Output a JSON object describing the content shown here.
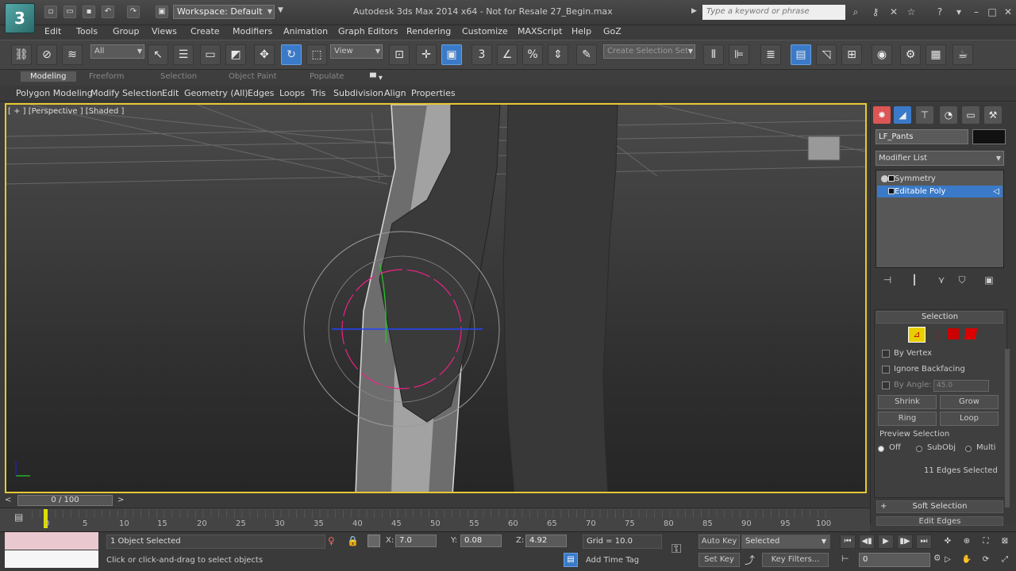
{
  "titlebar": {
    "title": "Autodesk 3ds Max  2014 x64   - Not for Resale   27_Begin.max",
    "workspace": "Workspace: Default",
    "search_placeholder": "Type a keyword or phrase"
  },
  "menu": [
    "Edit",
    "Tools",
    "Group",
    "Views",
    "Create",
    "Modifiers",
    "Animation",
    "Graph Editors",
    "Rendering",
    "Customize",
    "MAXScript",
    "Help",
    "GoZ"
  ],
  "toolbar": {
    "selection_filter": "All",
    "ref_coord": "View",
    "named_selection": "Create Selection Set",
    "snap_value": "3"
  },
  "ribbon": {
    "tabs": [
      "Modeling",
      "Freeform",
      "Selection",
      "Object Paint",
      "Populate"
    ],
    "active_tab": "Modeling",
    "commands": [
      "Polygon Modeling",
      "Modify Selection",
      "Edit",
      "Geometry (All)",
      "Edges",
      "Loops",
      "Tris",
      "Subdivision",
      "Align",
      "Properties"
    ]
  },
  "viewport": {
    "label": "[ + ] [Perspective ] [Shaded ]"
  },
  "command_panel": {
    "object_name": "LF_Pants",
    "object_color": "#111111",
    "modifier_list": "Modifier List",
    "stack": [
      {
        "label": "Symmetry",
        "selected": false
      },
      {
        "label": "Editable Poly",
        "selected": true
      }
    ],
    "selection_rollout": {
      "title": "Selection",
      "by_vertex": "By Vertex",
      "ignore_backfacing": "Ignore Backfacing",
      "by_angle": "By Angle:",
      "angle_value": "45.0",
      "shrink": "Shrink",
      "grow": "Grow",
      "ring": "Ring",
      "loop": "Loop",
      "preview_selection": "Preview Selection",
      "preview_options": [
        "Off",
        "SubObj",
        "Multi"
      ],
      "preview_selected": "Off",
      "status": "11 Edges Selected"
    },
    "soft_selection": "Soft Selection",
    "edit_edges": "Edit Edges"
  },
  "timeline": {
    "slider": "0 / 100",
    "ticks": [
      "0",
      "5",
      "10",
      "15",
      "20",
      "25",
      "30",
      "35",
      "40",
      "45",
      "50",
      "55",
      "60",
      "65",
      "70",
      "75",
      "80",
      "85",
      "90",
      "95",
      "100"
    ]
  },
  "status": {
    "objects_selected": "1 Object Selected",
    "prompt": "Click or click-and-drag to select objects",
    "x_label": "X:",
    "x_value": "7.0",
    "y_label": "Y:",
    "y_value": "0.08",
    "z_label": "Z:",
    "z_value": "4.92",
    "grid": "Grid = 10.0",
    "auto_key": "Auto Key",
    "set_key": "Set Key",
    "key_mode": "Selected",
    "key_filters": "Key Filters...",
    "add_time_tag": "Add Time Tag",
    "frame": "0"
  },
  "colors": {
    "accent": "#3a7ac8",
    "viewport_border": "#e8c830",
    "swatch_top": "#e9c9cf",
    "swatch_bottom": "#f6f6f6"
  }
}
